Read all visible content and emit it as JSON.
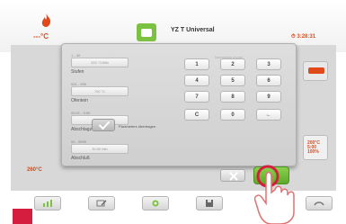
{
  "header": {
    "temperature": "---°C",
    "program_name": "YZ T Universal",
    "clock": "3:28:31"
  },
  "main": {
    "temperature_left": "260°C",
    "right_button_value": "200°C\n5:00\n100%"
  },
  "dialog": {
    "keypad_caption": "Numerieke invoer",
    "params": [
      {
        "small_label": "1 - 40",
        "value": "333 °C/Min",
        "name": "Stufen"
      },
      {
        "small_label": "001 - 999",
        "value": "700 °C",
        "name": "Ofentein"
      },
      {
        "small_label": "00:01 - 9:59",
        "value": "0600 °C",
        "name": "Abschlagzeit"
      },
      {
        "small_label": "00 - 9999",
        "value": "30:00 Min",
        "name": "Abschluß"
      }
    ],
    "keys": [
      "1",
      "2",
      "3",
      "4",
      "5",
      "6",
      "7",
      "8",
      "9",
      "C",
      "0",
      "←"
    ],
    "confirm_caption": "Parameters übertragen"
  },
  "colors": {
    "accent_green": "#7cc242",
    "accent_orange": "#e04a1a",
    "cancel_red": "#d41d3f"
  },
  "toolbar": {
    "icons": [
      "chart-icon",
      "edit-icon",
      "program-icon",
      "save-icon",
      "home-icon"
    ]
  }
}
